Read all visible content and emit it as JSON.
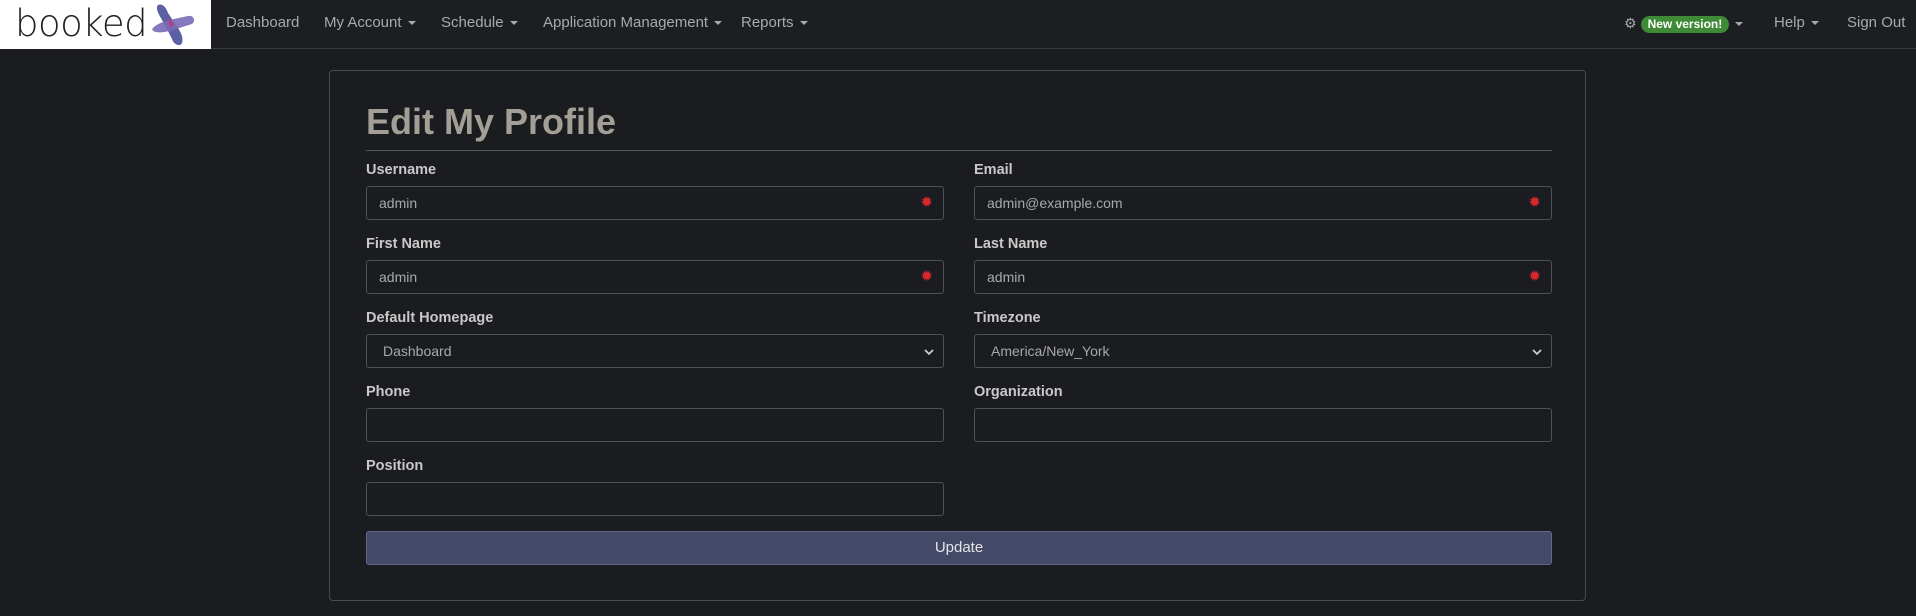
{
  "nav": {
    "brand": "booked",
    "items": [
      {
        "label": "Dashboard",
        "dropdown": false
      },
      {
        "label": "My Account",
        "dropdown": true
      },
      {
        "label": "Schedule",
        "dropdown": true
      },
      {
        "label": "Application Management",
        "dropdown": true
      },
      {
        "label": "Reports",
        "dropdown": true
      }
    ],
    "right": {
      "gear_icon": "gear-icon",
      "new_version": "New version!",
      "help": "Help",
      "sign_out": "Sign Out"
    }
  },
  "form": {
    "title": "Edit My Profile",
    "username": {
      "label": "Username",
      "value": "admin",
      "required": true
    },
    "email": {
      "label": "Email",
      "value": "admin@example.com",
      "required": true
    },
    "first_name": {
      "label": "First Name",
      "value": "admin",
      "required": true
    },
    "last_name": {
      "label": "Last Name",
      "value": "admin",
      "required": true
    },
    "default_homepage": {
      "label": "Default Homepage",
      "value": "Dashboard"
    },
    "timezone": {
      "label": "Timezone",
      "value": "America/New_York"
    },
    "phone": {
      "label": "Phone",
      "value": ""
    },
    "organization": {
      "label": "Organization",
      "value": ""
    },
    "position": {
      "label": "Position",
      "value": ""
    },
    "required_marker": "✹",
    "update": "Update"
  },
  "colors": {
    "background": "#1b1c1f",
    "title": "#a39f96",
    "badge": "#3f8a36",
    "required": "#d9272e",
    "update_button": "#444968"
  }
}
